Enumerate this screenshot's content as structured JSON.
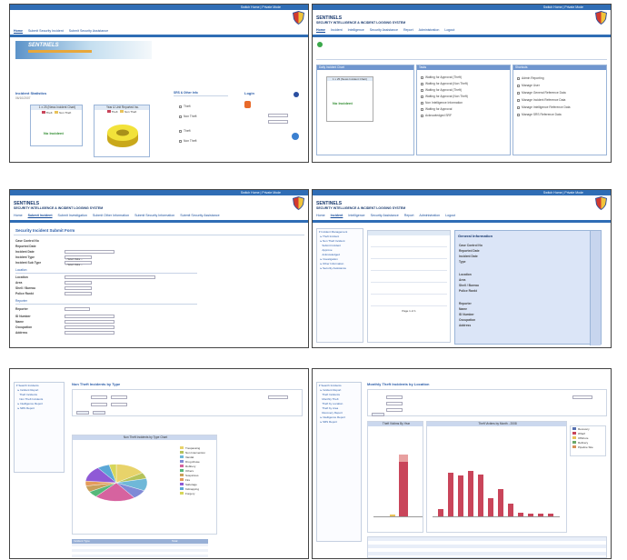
{
  "header": {
    "brand": "SENTINELS",
    "tagline": "SECURITY INTELLIGENCE & INCIDENT LOGGING SYSTEM",
    "top_links": "Switch Home | Private Mode"
  },
  "tile1": {
    "nav": [
      "Home",
      "Submit Security Incident",
      "Submit Security Assistance"
    ],
    "banner": "SENTINELS",
    "stats_title": "Incident Statistics",
    "chart_title": "1 x 25 (News Incident Chart)",
    "chart_title2": "Year & Unit Reported Inc.",
    "legend_theft": "Theft",
    "legend_non_theft": "Non Theft",
    "no_incident": "No Incident",
    "info_title": "SRS & Other Info",
    "login_title": "Login"
  },
  "tile2": {
    "nav": [
      "Home",
      "Incident",
      "Intelligence",
      "Security Assistance",
      "Report",
      "Administration",
      "Logout"
    ],
    "panel_left": "Daily Incident Chart",
    "panel_mid": "Tasks",
    "panel_right": "Shortcuts",
    "chart_title": "1 x 25 (News Incident Chart)",
    "no_incident": "No Incident",
    "tasks": [
      "Waiting for Approval (Theft)",
      "Waiting for Approval (Non Theft)",
      "Waiting for Approval (Theft)",
      "Waiting for Approval (Non Theft)",
      "Non Intelligence Information",
      "Waiting for Approval",
      "Acknowledged SRF"
    ],
    "shortcuts": [
      "Admin Reporting",
      "Manage User",
      "Manage General Reference Data",
      "Manage Incident Reference Data",
      "Manage Intelligence Reference Data",
      "Manage SRS Reference Data"
    ]
  },
  "tile3": {
    "nav": [
      "Home",
      "Submit Incident",
      "Submit Investigation",
      "Submit Other Information",
      "Submit Security Information",
      "Submit Security Assistance"
    ],
    "form_title": "Security Incident Submit Form",
    "fields": [
      "Case Control No",
      "Reported Date",
      "Incident Date",
      "Incident Type",
      "Incident Sub Type"
    ],
    "location_section": "Location",
    "location_fields": [
      "Location",
      "Area",
      "Shell / Bureau",
      "Police Rankt"
    ],
    "reporter_section": "Reporter",
    "reporter_fields": [
      "Reporter",
      "ID Number",
      "Name",
      "Occupation",
      "Address"
    ],
    "select_placeholder": "-- Select Value --"
  },
  "tile4": {
    "nav": [
      "Home",
      "Incident",
      "Intelligence",
      "Security Assistance",
      "Report",
      "Administration",
      "Logout"
    ],
    "general_title": "General Information",
    "general_fields": [
      "Case Control No",
      "Reported Date",
      "Incident Date",
      "Type"
    ],
    "location_fields": [
      "Location",
      "Area",
      "Shell / Bureau",
      "Police Rankt"
    ],
    "reporter_fields": [
      "Reporter",
      "Name",
      "ID Number",
      "Occupation",
      "Address"
    ],
    "paging": "Page 1 of 1"
  },
  "tile5": {
    "title": "Non Theft Incidents by Type",
    "chart_title": "Non Theft Incidents by Type Chart",
    "legend": [
      "Trespassing",
      "Non Intervention",
      "Vandal",
      "Drug Abuse",
      "Robbery",
      "Others",
      "Suspicious",
      "Fire",
      "Sabotage",
      "Kidnapping",
      "Forgery"
    ],
    "legend_colors": [
      "#e8d36a",
      "#b5c35a",
      "#6fb8d8",
      "#7f8ad6",
      "#d6639f",
      "#56b87a",
      "#c9a05a",
      "#e49c5a",
      "#8f5ad6",
      "#5aa7d6",
      "#d6d65a"
    ],
    "table_header": [
      "Incident Type",
      "Total"
    ]
  },
  "tile6": {
    "title": "Monthly Theft Incidents by Location",
    "chart1_title": "Theft Victims By Year",
    "chart2_title": "Theft Victims by Month - 2008",
    "y_label": "Theft by Location",
    "x_label": "Month",
    "legend": [
      "Recovery",
      "Wharf",
      "Offshore",
      "Refinery",
      "Pipeline Site"
    ],
    "legend_colors": [
      "#5570b0",
      "#c9455a",
      "#e8c25a",
      "#6aa86a",
      "#d6905a"
    ]
  }
}
